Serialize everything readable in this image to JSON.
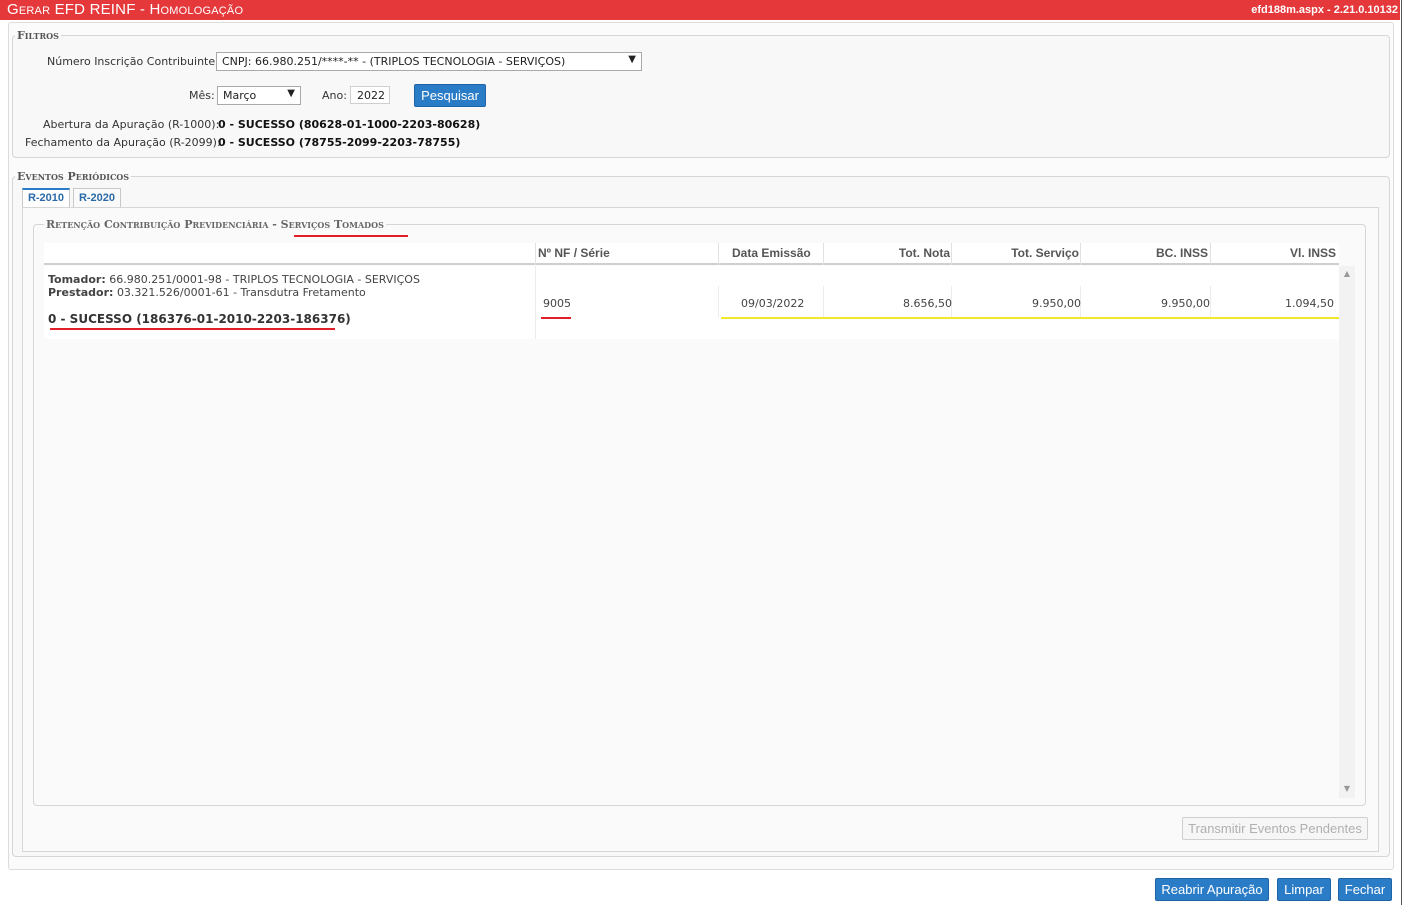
{
  "window": {
    "title": "Gerar EFD REINF  - Homologação",
    "version": "efd188m.aspx - 2.21.0.10132"
  },
  "filtros": {
    "legend": "Filtros",
    "contribuinte_label": "Número Inscrição Contribuinte:",
    "contribuinte_value": "CNPJ: 66.980.251/****-** - (TRIPLOS TECNOLOGIA - SERVIÇOS)",
    "mes_label": "Mês:",
    "mes_value": "Março",
    "ano_label": "Ano:",
    "ano_value": "2022",
    "pesquisar_label": "Pesquisar",
    "abertura_label": "Abertura da Apuração (R-1000):",
    "abertura_value": "0 - SUCESSO (80628-01-1000-2203-80628)",
    "fechamento_label": "Fechamento da Apuração (R-2099):",
    "fechamento_value": "0 - SUCESSO (78755-2099-2203-78755)"
  },
  "eventos": {
    "legend": "Eventos Periódicos",
    "tabs": [
      "R-2010",
      "R-2020"
    ],
    "active_tab": "R-2010",
    "sub_legend_part1": "Retenção Contribuição Previdenciária - ",
    "sub_legend_part2": "Serviços Tomados",
    "columns": [
      "Nº NF / Série",
      "Data Emissão",
      "Tot. Nota",
      "Tot. Serviço",
      "BC. INSS",
      "Vl. INSS"
    ],
    "rows": [
      {
        "tomador_label": "Tomador:",
        "tomador_value": "66.980.251/0001-98 - TRIPLOS TECNOLOGIA - SERVIÇOS",
        "prestador_label": "Prestador:",
        "prestador_value": "03.321.526/0001-61 - Transdutra Fretamento",
        "status": "0 - SUCESSO (186376-01-2010-2203-186376)",
        "nf_serie": "9005",
        "data_emissao": "09/03/2022",
        "tot_nota": "8.656,50",
        "tot_servico": "9.950,00",
        "bc_inss": "9.950,00",
        "vl_inss": "1.094,50"
      }
    ],
    "transmitir_label": "Transmitir Eventos Pendentes"
  },
  "footer": {
    "reabrir_label": "Reabrir Apuração",
    "limpar_label": "Limpar",
    "fechar_label": "Fechar"
  },
  "colors": {
    "titlebar": "#e5383b",
    "primary_button": "#2b7cc7",
    "annotation_red": "#e21f26",
    "annotation_yellow": "#f0e92a"
  }
}
